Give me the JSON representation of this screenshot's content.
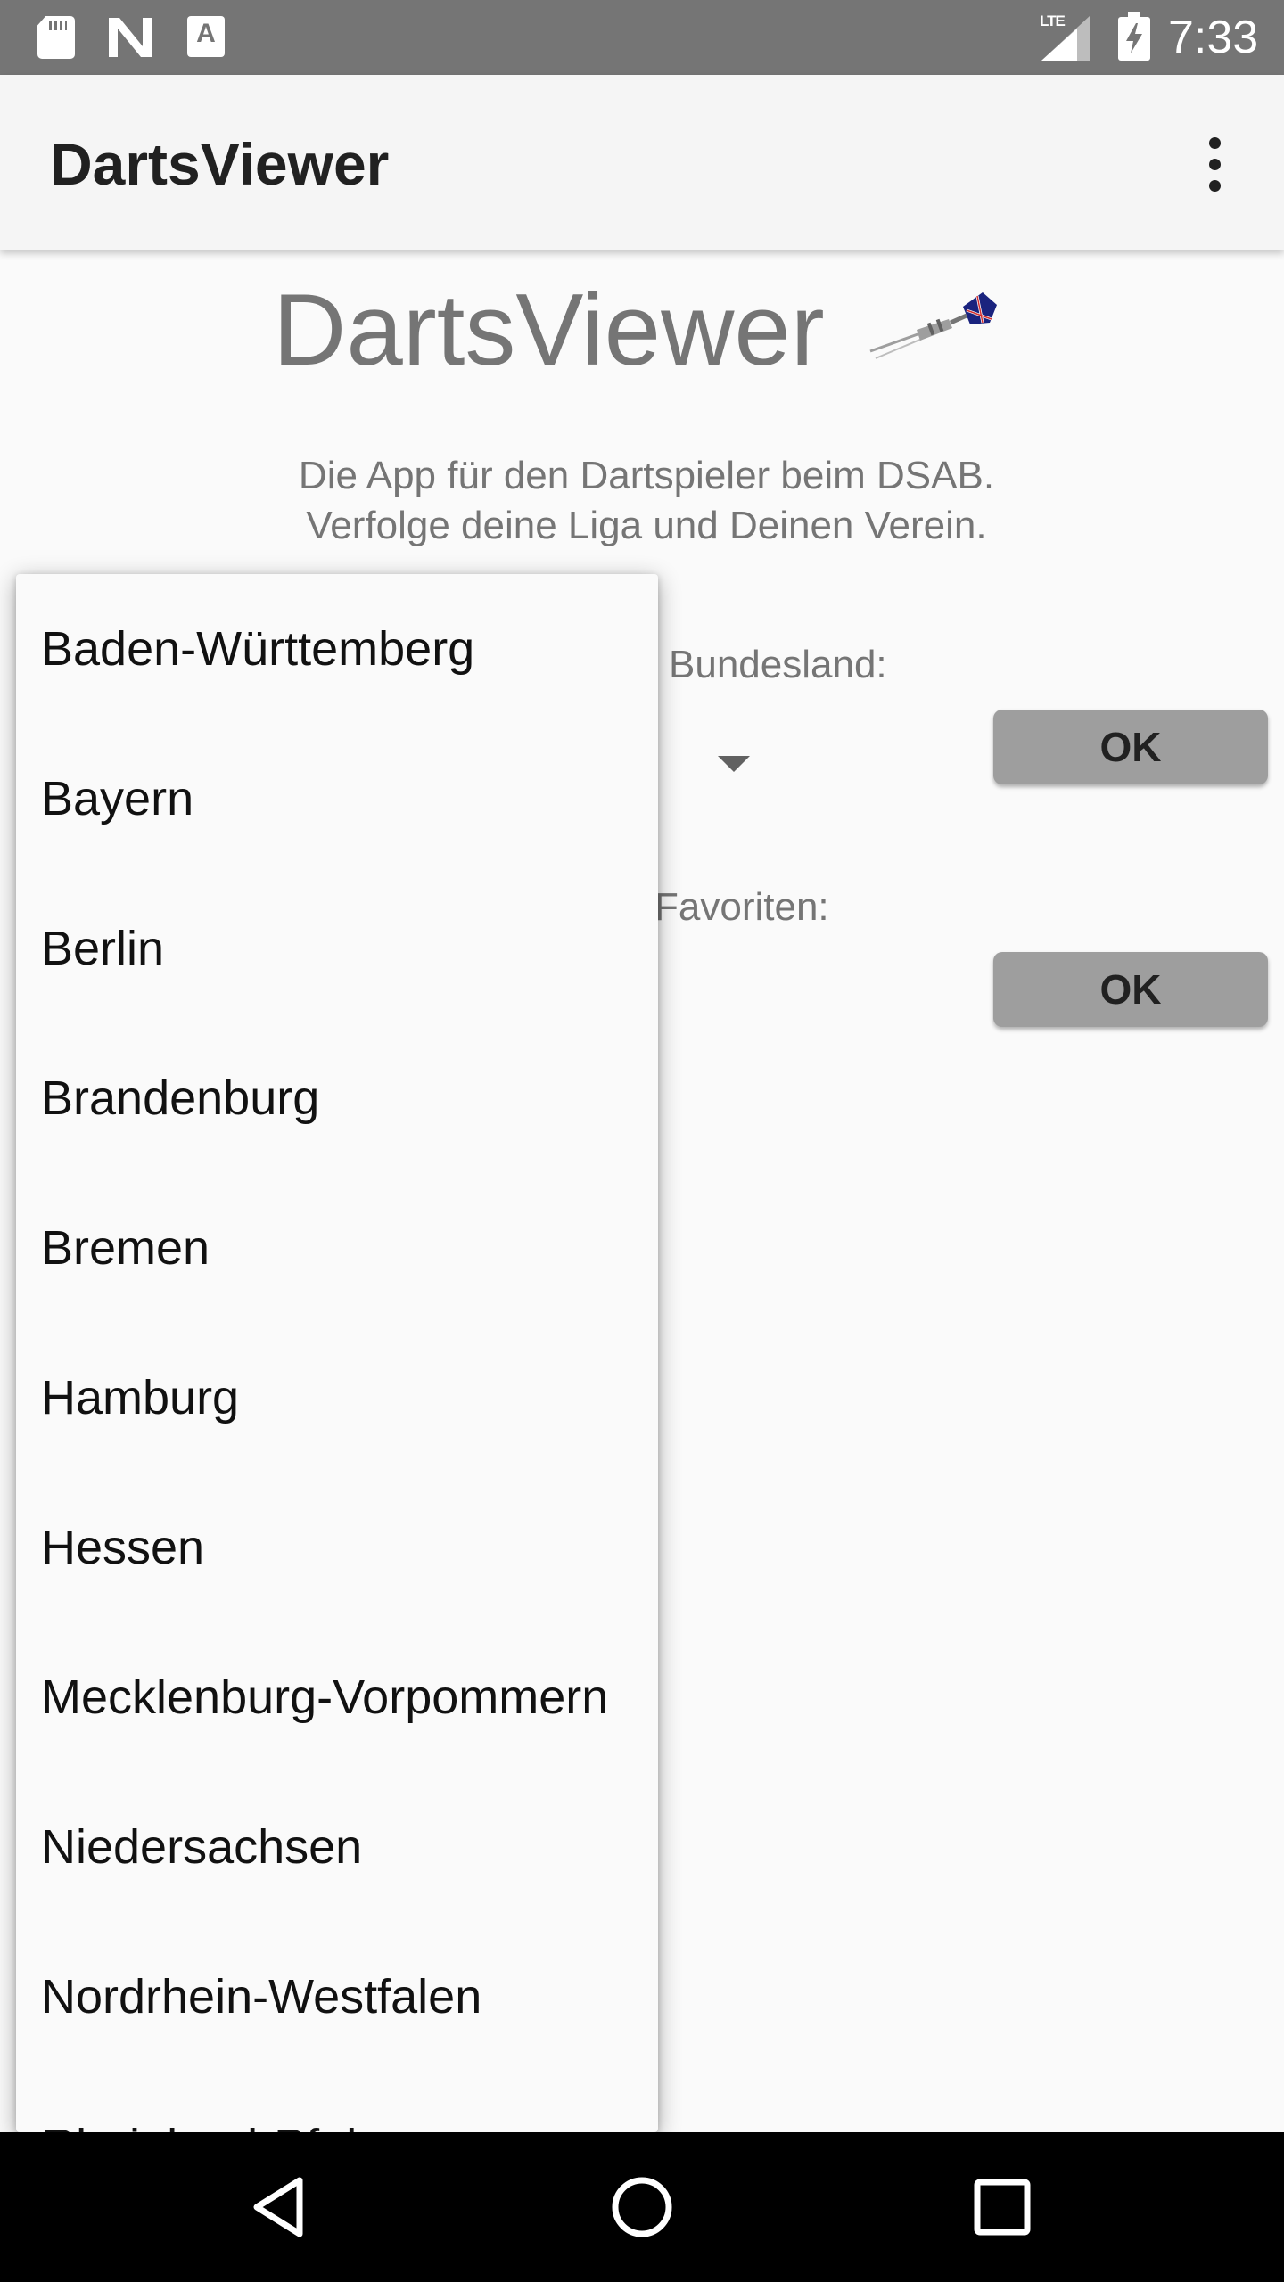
{
  "status_bar": {
    "icons": [
      "sd-card-icon",
      "n-notification-icon",
      "a-notification-icon",
      "lte-signal-icon",
      "battery-charging-icon"
    ],
    "network": "LTE",
    "time": "7:33"
  },
  "app_bar": {
    "title": "DartsViewer",
    "menu_icon": "overflow-menu-icon"
  },
  "main": {
    "hero_title": "DartsViewer",
    "hero_icon": "dart-icon",
    "intro_line1": "Die App für den Dartspieler beim DSAB.",
    "intro_line2": "Verfolge deine Liga und Deinen Verein.",
    "bundesland_label": "Bundesland:",
    "bundesland_ok": "OK",
    "favoriten_label": "Favoriten:",
    "favoriten_ok": "OK"
  },
  "dropdown": {
    "items": [
      "Baden-Württemberg",
      "Bayern",
      "Berlin",
      "Brandenburg",
      "Bremen",
      "Hamburg",
      "Hessen",
      "Mecklenburg-Vorpommern",
      "Niedersachsen",
      "Nordrhein-Westfalen",
      "Rheinland-Pfalz"
    ]
  },
  "nav_bar": {
    "buttons": [
      "back-icon",
      "home-icon",
      "recents-icon"
    ]
  },
  "colors": {
    "status_bar": "#757575",
    "app_bar": "#f5f5f5",
    "background": "#fafafa",
    "button": "#9e9e9e",
    "secondary_text": "#757575"
  }
}
